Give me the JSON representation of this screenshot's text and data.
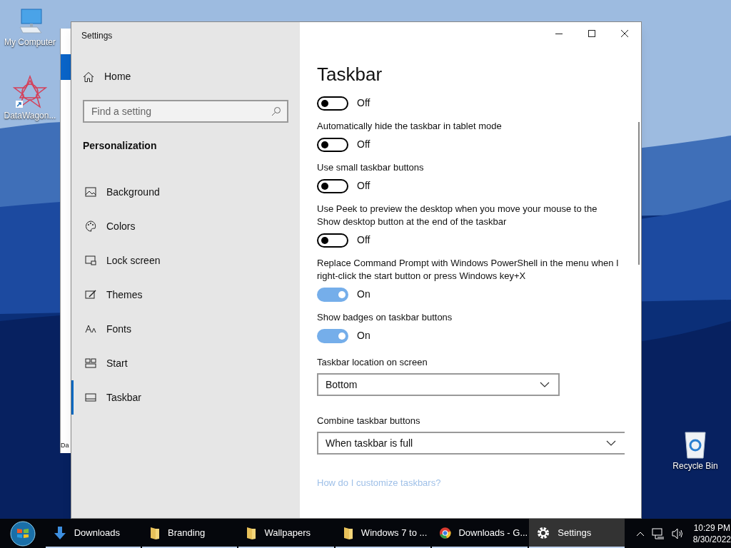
{
  "desktop_icons": [
    {
      "label": "My Computer",
      "kind": "computer"
    },
    {
      "label": "DataWagon...",
      "kind": "shortcut"
    },
    {
      "label": "Recycle Bin",
      "kind": "bin"
    }
  ],
  "background_window": {
    "text": "Da"
  },
  "settings_window": {
    "title": "Settings",
    "home": "Home",
    "search": {
      "placeholder": "Find a setting"
    },
    "section": "Personalization",
    "nav_items": [
      {
        "label": "Background",
        "selected": false
      },
      {
        "label": "Colors",
        "selected": false
      },
      {
        "label": "Lock screen",
        "selected": false
      },
      {
        "label": "Themes",
        "selected": false
      },
      {
        "label": "Fonts",
        "selected": false
      },
      {
        "label": "Start",
        "selected": false
      },
      {
        "label": "Taskbar",
        "selected": true
      }
    ],
    "heading": "Taskbar",
    "settings": [
      {
        "kind": "toggle",
        "on": false,
        "state_text": "Off"
      },
      {
        "kind": "toggle",
        "label": "Automatically hide the taskbar in tablet mode",
        "on": false,
        "state_text": "Off"
      },
      {
        "kind": "toggle",
        "label": "Use small taskbar buttons",
        "on": false,
        "state_text": "Off"
      },
      {
        "kind": "toggle",
        "label": "Use Peek to preview the desktop when you move your mouse to the Show desktop button at the end of the taskbar",
        "on": false,
        "state_text": "Off"
      },
      {
        "kind": "toggle",
        "label": "Replace Command Prompt with Windows PowerShell in the menu when I right-click the start button or press Windows key+X",
        "on": true,
        "state_text": "On"
      },
      {
        "kind": "toggle",
        "label": "Show badges on taskbar buttons",
        "on": true,
        "state_text": "On"
      },
      {
        "kind": "dropdown",
        "label": "Taskbar location on screen",
        "value": "Bottom"
      },
      {
        "kind": "dropdown",
        "label": "Combine taskbar buttons",
        "value": "When taskbar is full"
      }
    ],
    "link": "How do I customize taskbars?"
  },
  "taskbar": {
    "items": [
      {
        "label": "Downloads",
        "kind": "download",
        "selected": false
      },
      {
        "label": "Branding",
        "kind": "folder",
        "selected": false
      },
      {
        "label": "Wallpapers",
        "kind": "folder",
        "selected": false
      },
      {
        "label": "Windows 7 to ...",
        "kind": "folder",
        "selected": false
      },
      {
        "label": "Downloads - G...",
        "kind": "browser",
        "selected": false
      },
      {
        "label": "Settings",
        "kind": "gear",
        "selected": true
      }
    ],
    "time": "10:29 PM",
    "date": "8/30/2022"
  }
}
